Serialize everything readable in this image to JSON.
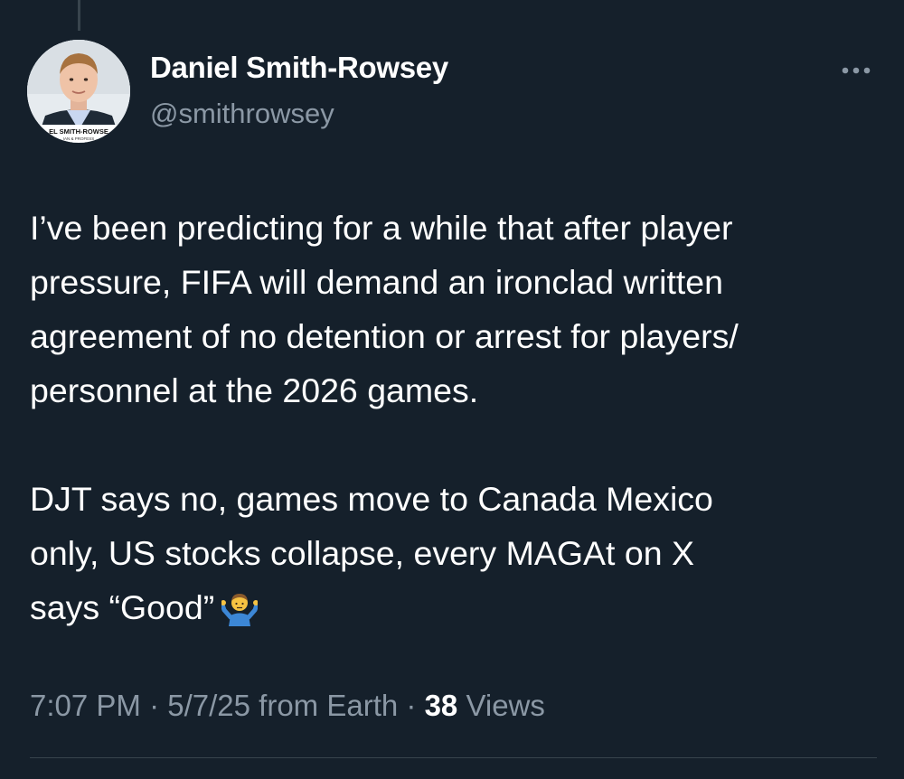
{
  "author": {
    "name": "Daniel Smith-Rowsey",
    "handle": "@smithrowsey",
    "avatar_banner_text": "EL SMITH-ROWSE",
    "avatar_banner_subtext": "IAN & PROFESS"
  },
  "tweet": {
    "paragraph_1": "I’ve been predicting for a while that after player\npressure, FIFA will demand an ironclad written\nagreement of no detention or arrest for players/\npersonnel at the 2026 games.",
    "paragraph_2": "DJT says no, games move to Canada Mexico\nonly, US stocks collapse, every MAGAt on X\nsays “Good”",
    "emoji": "person-shrugging-emoji"
  },
  "meta": {
    "time": "7:07 PM",
    "separator": "·",
    "date": "5/7/25",
    "source": "from Earth",
    "views_count": "38",
    "views_label": "Views"
  },
  "icons": {
    "more": "more-horizontal-icon"
  },
  "colors": {
    "background": "#15202b",
    "primary_text": "#ffffff",
    "secondary_text": "#8b98a5",
    "divider": "#38444d"
  }
}
